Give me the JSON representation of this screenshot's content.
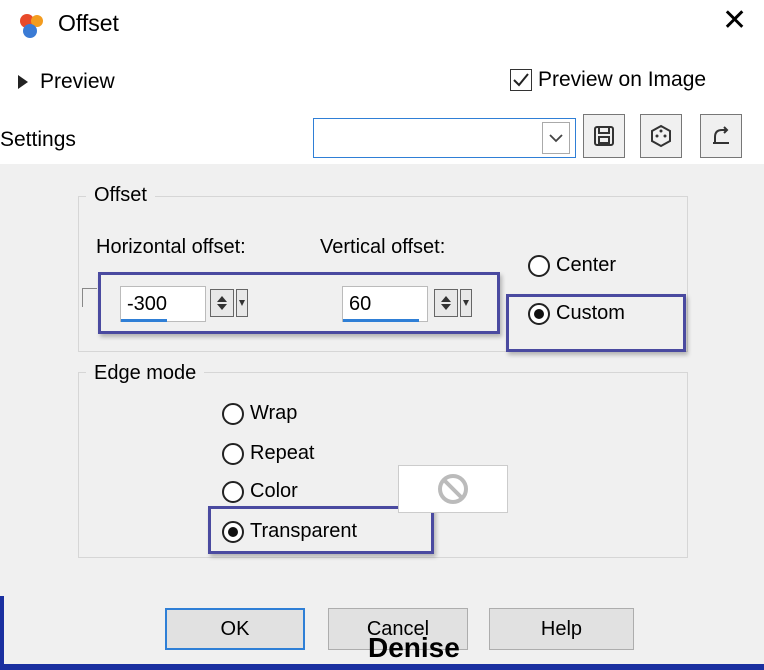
{
  "window": {
    "title": "Offset",
    "close_glyph": "✕"
  },
  "preview": {
    "label": "Preview",
    "preview_on_image_label": "Preview on Image",
    "preview_on_image_checked": true
  },
  "settings": {
    "label": "Settings",
    "value": ""
  },
  "offset": {
    "group_label": "Offset",
    "horizontal_label": "Horizontal offset:",
    "vertical_label": "Vertical offset:",
    "horizontal_value": "-300",
    "vertical_value": "60",
    "center_label": "Center",
    "custom_label": "Custom",
    "selected": "Custom"
  },
  "edge_mode": {
    "group_label": "Edge mode",
    "options": [
      "Wrap",
      "Repeat",
      "Color",
      "Transparent"
    ],
    "selected": "Transparent"
  },
  "buttons": {
    "ok": "OK",
    "cancel": "Cancel",
    "help": "Help"
  },
  "watermark": "Denise",
  "colors": {
    "accent": "#2f7fd6",
    "highlight": "#4a4aa0",
    "panel": "#f0f0f0",
    "edge": "#1a2fa0"
  },
  "icons": [
    "app-icon",
    "close-icon",
    "preview-expand-icon",
    "checkmark-icon",
    "chevron-down-icon",
    "save-icon",
    "random-dice-icon",
    "reset-icon",
    "spin-up-icon",
    "spin-down-icon",
    "no-color-icon"
  ]
}
